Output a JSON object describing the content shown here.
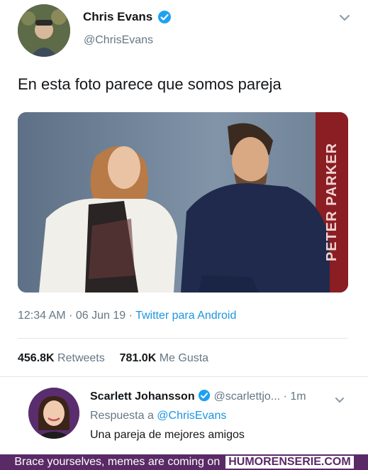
{
  "tweet": {
    "author_name": "Chris Evans",
    "author_handle": "@ChrisEvans",
    "text": "En esta foto parece que somos pareja",
    "time": "12:34 AM",
    "separator": "·",
    "date": "06 Jun 19",
    "source": "Twitter para Android",
    "retweets_count": "456.8K",
    "retweets_label": "Retweets",
    "likes_count": "781.0K",
    "likes_label": "Me Gusta",
    "photo_watermark": "PETER PARKER"
  },
  "reply": {
    "author_name": "Scarlett Johansson",
    "author_handle": "@scarlettjo...",
    "time": "· 1m",
    "replying_to_prefix": "Respuesta a",
    "replying_to_handle": "@ChrisEvans",
    "text": "Una pareja de mejores amigos"
  },
  "footer": {
    "text": "Brace yourselves, memes are coming on",
    "brand": "HUMORENSERIE.COM"
  },
  "colors": {
    "verified": "#1da1f2",
    "link": "#1b95e0",
    "footer_bg": "#5a2a66"
  },
  "icons": [
    "verified-badge-icon",
    "chevron-down-icon"
  ]
}
